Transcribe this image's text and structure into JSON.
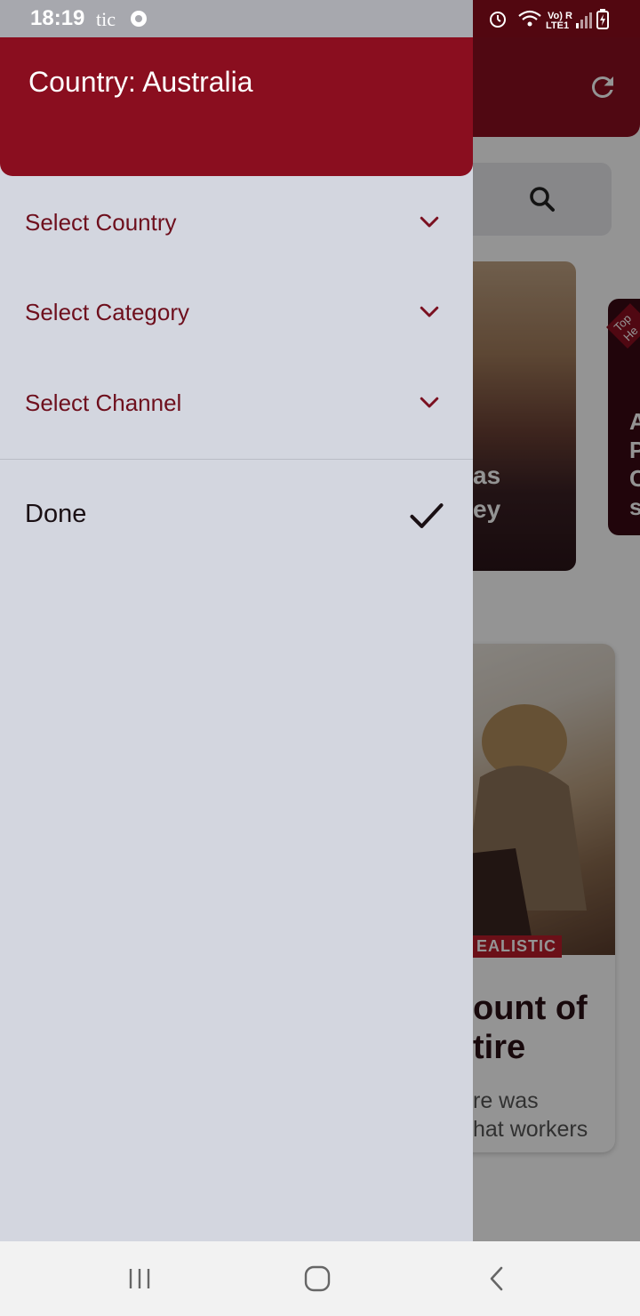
{
  "status_bar": {
    "time": "18:19",
    "carrier": "tic",
    "signal_label": "Vo) R LTE1",
    "icons": [
      "alarm-icon",
      "wifi-icon",
      "signal-icon",
      "battery-icon"
    ]
  },
  "drawer": {
    "title": "Country: Australia",
    "items": [
      {
        "label": "Select Country",
        "icon": "chevron-down-icon"
      },
      {
        "label": "Select Category",
        "icon": "chevron-down-icon"
      },
      {
        "label": "Select Channel",
        "icon": "chevron-down-icon"
      }
    ],
    "done_label": "Done",
    "done_icon": "check-icon"
  },
  "background": {
    "card1_text_lines": [
      "as",
      "ey"
    ],
    "card2_text_lines": [
      "A",
      "P",
      "C",
      "s"
    ],
    "top_headline_tag": "Top He",
    "article_tag": "EALISTIC",
    "article_title_lines": [
      "ount of",
      "tire"
    ],
    "article_snippet_lines": [
      "re was",
      "hat workers"
    ]
  },
  "nav_bar": {
    "buttons": [
      "recent-apps-icon",
      "home-icon",
      "back-icon"
    ]
  },
  "colors": {
    "brand": "#8a0e1f",
    "drawer_bg": "#d3d6df",
    "menu_text": "#6e0f1d"
  }
}
